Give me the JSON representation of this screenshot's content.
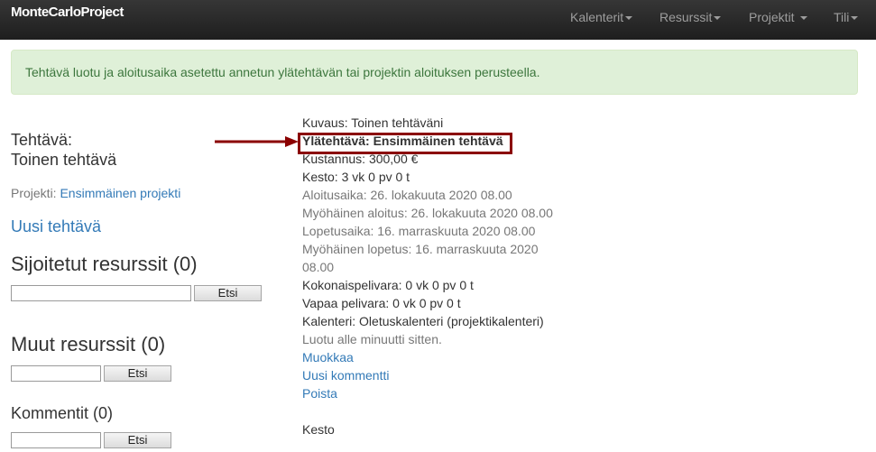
{
  "navbar": {
    "brand": "MonteCarloProject",
    "items": [
      {
        "label": "Kalenterit"
      },
      {
        "label": "Resurssit"
      },
      {
        "label": "Projektit"
      },
      {
        "label": "Tili"
      }
    ]
  },
  "alert": {
    "text": "Tehtävä luotu ja aloitusaika asetettu annetun ylätehtävän tai projektin aloituksen perusteella."
  },
  "task": {
    "heading_label": "Tehtävä:",
    "name": "Toinen tehtävä",
    "project_label": "Projekti:",
    "project_link": "Ensimmäinen projekti",
    "new_task_link": "Uusi tehtävä"
  },
  "assigned_resources": {
    "heading": "Sijoitetut resurssit (0)",
    "search_button": "Etsi"
  },
  "other_resources": {
    "heading": "Muut resurssit (0)",
    "search_button": "Etsi"
  },
  "comments": {
    "heading": "Kommentit (0)",
    "search_button": "Etsi"
  },
  "details": {
    "description": "Kuvaus: Toinen tehtäväni",
    "parent_task": "Ylätehtävä: Ensimmäinen tehtävä",
    "cost": "Kustannus: 300,00 €",
    "duration": "Kesto: 3 vk 0 pv 0 t",
    "start": "Aloitusaika: 26. lokakuuta 2020 08.00",
    "late_start": "Myöhäinen aloitus: 26. lokakuuta 2020 08.00",
    "end": "Lopetusaika: 16. marraskuuta 2020 08.00",
    "late_end": "Myöhäinen lopetus: 16. marraskuuta 2020 08.00",
    "total_float": "Kokonaispelivara: 0 vk 0 pv 0 t",
    "free_float": "Vapaa pelivara: 0 vk 0 pv 0 t",
    "calendar": "Kalenteri: Oletuskalenteri (projektikalenteri)",
    "created": "Luotu alle minuutti sitten.",
    "edit_link": "Muokkaa",
    "new_comment_link": "Uusi kommentti",
    "delete_link": "Poista",
    "duration_heading": "Kesto"
  },
  "colors": {
    "navbar_background": "#222222",
    "navbar_text": "#9d9d9d",
    "alert_background": "#dff0d8",
    "alert_text": "#3c763d",
    "link": "#337ab7",
    "muted_text": "#777777",
    "annotation": "#8b0000"
  },
  "icons": {
    "dropdown": "caret-down-icon",
    "annotation_arrow": "arrow-right-icon"
  }
}
